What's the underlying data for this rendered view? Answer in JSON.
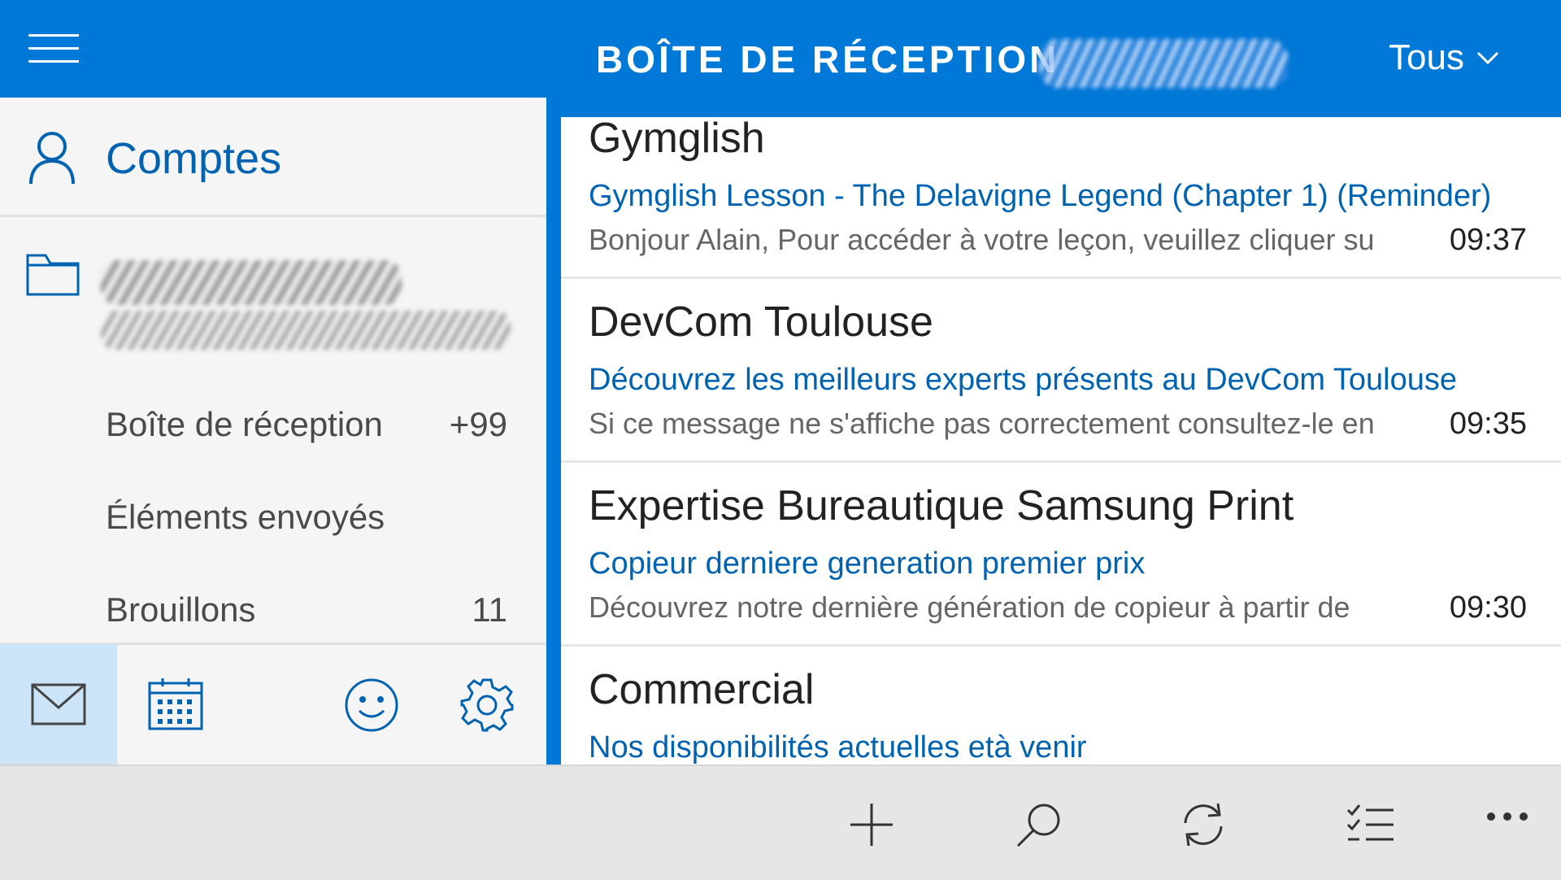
{
  "header": {
    "title": "BOÎTE DE RÉCEPTION",
    "filter_label": "Tous"
  },
  "sidebar": {
    "accounts_label": "Comptes",
    "folders": [
      {
        "name": "Boîte de réception",
        "count": "+99"
      },
      {
        "name": "Éléments envoyés",
        "count": ""
      },
      {
        "name": "Brouillons",
        "count": "11"
      }
    ]
  },
  "nav": [
    "mail-icon",
    "calendar-icon",
    "feedback-icon",
    "settings-icon"
  ],
  "messages": [
    {
      "sender": "Gymglish",
      "subject": "Gymglish Lesson - The Delavigne Legend (Chapter 1) (Reminder)",
      "preview": "Bonjour Alain, Pour accéder à votre leçon, veuillez cliquer su",
      "time": "09:37"
    },
    {
      "sender": "DevCom Toulouse",
      "subject": "Découvrez les meilleurs experts présents au DevCom Toulouse",
      "preview": "Si ce message ne s'affiche pas correctement consultez-le en",
      "time": "09:35"
    },
    {
      "sender": "Expertise Bureautique Samsung Print",
      "subject": "Copieur derniere generation premier prix",
      "preview": "Découvrez notre dernière génération de copieur à partir de",
      "time": "09:30"
    },
    {
      "sender": "Commercial",
      "subject": "Nos disponibilités actuelles età venir",
      "preview": "",
      "time": ""
    }
  ],
  "appbar": [
    "add-icon",
    "search-icon",
    "sync-icon",
    "select-icon",
    "more-icon"
  ],
  "colors": {
    "accent": "#0078d7",
    "subject": "#0063b1",
    "sidebar_bg": "#f5f5f5",
    "appbar_bg": "#e6e6e6"
  }
}
